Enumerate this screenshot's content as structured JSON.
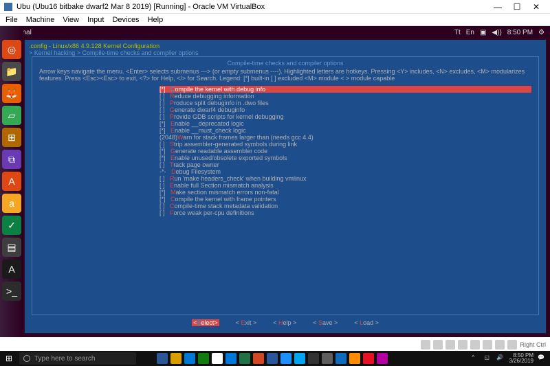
{
  "vb": {
    "title": "Ubu (Ubu16 bitbake dwarf2 Mar 8 2019) [Running] - Oracle VM VirtualBox",
    "menu": [
      "File",
      "Machine",
      "View",
      "Input",
      "Devices",
      "Help"
    ],
    "status_right": "Right Ctrl"
  },
  "ubuntu": {
    "topbar_title": "Terminal",
    "topbar_right": [
      "Tt",
      "En",
      "▣",
      "◀))",
      "8:50 PM",
      "⚙"
    ]
  },
  "kernel": {
    "path1": ".config - Linux/x86 4.9.128 Kernel Configuration",
    "path2": "> Kernel hacking > Compile-time checks and compiler options",
    "title": "Compile-time checks and compiler options",
    "help": "Arrow keys navigate the menu.  <Enter> selects submenus ---> (or empty submenus ----).  Highlighted letters are hotkeys.  Pressing <Y> includes, <N> excludes, <M> modularizes features.  Press <Esc><Esc> to exit, <?> for Help, </> for Search.  Legend: [*] built-in  [ ] excluded  <M> module  < > module capable",
    "items": [
      {
        "mark": "[*]",
        "hl": "C",
        "label": "ompile the kernel with debug info"
      },
      {
        "mark": "[ ]",
        "hl": "R",
        "label": "educe debugging information"
      },
      {
        "mark": "[ ]",
        "hl": "P",
        "label": "roduce split debuginfo in .dwo files"
      },
      {
        "mark": "[ ]",
        "hl": "G",
        "label": "enerate dwarf4 debuginfo"
      },
      {
        "mark": "[ ]",
        "hl": "P",
        "label": "rovide GDB scripts for kernel debugging"
      },
      {
        "mark": "[*]",
        "hl": "E",
        "label": "nable __deprecated logic"
      },
      {
        "mark": "[*]",
        "hl": "E",
        "label": "nable __must_check logic"
      },
      {
        "mark": "(2048)",
        "hl": "W",
        "label": "arn for stack frames larger than (needs gcc 4.4)"
      },
      {
        "mark": "[ ]",
        "hl": "S",
        "label": "trip assembler-generated symbols during link"
      },
      {
        "mark": "[*]",
        "hl": "G",
        "label": "enerate readable assembler code"
      },
      {
        "mark": "[*]",
        "hl": "E",
        "label": "nable unused/obsolete exported symbols"
      },
      {
        "mark": "[ ]",
        "hl": "T",
        "label": "rack page owner"
      },
      {
        "mark": "-*-",
        "hl": "D",
        "label": "ebug Filesystem"
      },
      {
        "mark": "[ ]",
        "hl": "R",
        "label": "un 'make headers_check' when building vmlinux"
      },
      {
        "mark": "[ ]",
        "hl": "E",
        "label": "nable full Section mismatch analysis"
      },
      {
        "mark": "[*]",
        "hl": "M",
        "label": "ake section mismatch errors non-fatal"
      },
      {
        "mark": "[*]",
        "hl": "C",
        "label": "ompile the kernel with frame pointers"
      },
      {
        "mark": "[ ]",
        "hl": "C",
        "label": "ompile-time stack metadata validation"
      },
      {
        "mark": "[ ]",
        "hl": "F",
        "label": "orce weak per-cpu definitions"
      }
    ],
    "buttons": [
      {
        "hl": "S",
        "label": "elect",
        "sel": true
      },
      {
        "hl": "E",
        "label": "xit",
        "sel": false
      },
      {
        "hl": "H",
        "label": "elp",
        "sel": false
      },
      {
        "hl": "S",
        "label": "ave",
        "sel": false
      },
      {
        "hl": "L",
        "label": "oad",
        "sel": false
      }
    ],
    "selected_index": 0
  },
  "launcher": [
    {
      "bg": "#dd4814",
      "glyph": "◎"
    },
    {
      "bg": "#4a4a4a",
      "glyph": "📁"
    },
    {
      "bg": "#e66000",
      "glyph": "🦊"
    },
    {
      "bg": "#34a853",
      "glyph": "▱"
    },
    {
      "bg": "#b06700",
      "glyph": "⊞"
    },
    {
      "bg": "#6a3ab2",
      "glyph": "⧉"
    },
    {
      "bg": "#dd4814",
      "glyph": "A"
    },
    {
      "bg": "#f5a623",
      "glyph": "a"
    },
    {
      "bg": "#0b8043",
      "glyph": "✓"
    },
    {
      "bg": "#3e3e3e",
      "glyph": "▤"
    },
    {
      "bg": "#1a1a1a",
      "glyph": "A"
    },
    {
      "bg": "#2c2c2c",
      "glyph": ">_"
    }
  ],
  "win": {
    "search_placeholder": "Type here to search",
    "clock_time": "8:50 PM",
    "clock_date": "3/26/2019",
    "task_icons": [
      {
        "bg": "#2b5797"
      },
      {
        "bg": "#d89e00"
      },
      {
        "bg": "#0078d4"
      },
      {
        "bg": "#107c10"
      },
      {
        "bg": "#ffffff"
      },
      {
        "bg": "#0078d7"
      },
      {
        "bg": "#217346"
      },
      {
        "bg": "#d24726"
      },
      {
        "bg": "#2b579a"
      },
      {
        "bg": "#1e90ff"
      },
      {
        "bg": "#00a4ef"
      },
      {
        "bg": "#333333"
      },
      {
        "bg": "#5e5e5e"
      },
      {
        "bg": "#0f6cbd"
      },
      {
        "bg": "#ff8c00"
      },
      {
        "bg": "#e81123"
      },
      {
        "bg": "#b4009e"
      }
    ]
  }
}
